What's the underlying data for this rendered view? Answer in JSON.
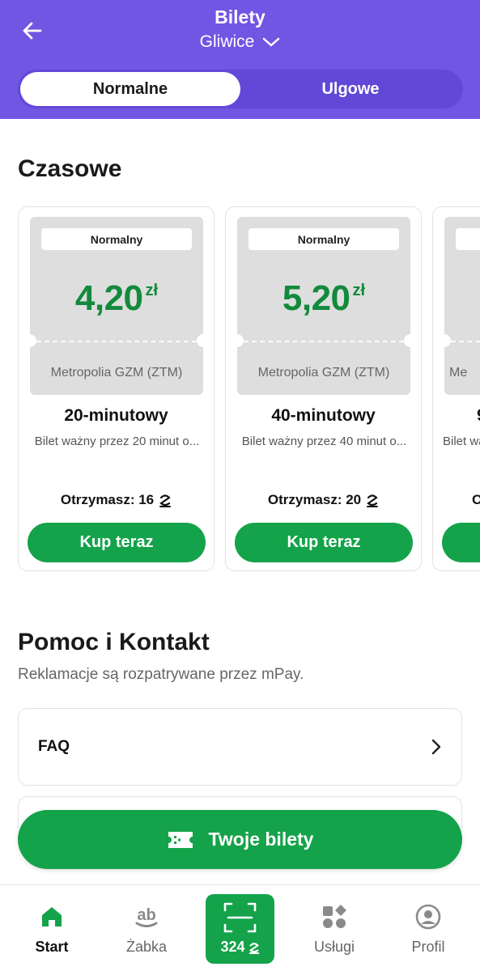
{
  "header": {
    "title": "Bilety",
    "city": "Gliwice",
    "tabs": [
      {
        "label": "Normalne",
        "active": true
      },
      {
        "label": "Ulgowe",
        "active": false
      }
    ]
  },
  "colors": {
    "header_bg": "#7155e3",
    "accent_green": "#14a34a",
    "price_green": "#128a3c"
  },
  "section_timed": {
    "title": "Czasowe",
    "cards": [
      {
        "badge": "Normalny",
        "price": "4,20",
        "currency": "zł",
        "operator": "Metropolia GZM (ZTM)",
        "name": "20-minutowy",
        "description": "Bilet ważny przez 20 minut o...",
        "points_label": "Otrzymasz: 16",
        "button": "Kup teraz"
      },
      {
        "badge": "Normalny",
        "price": "5,20",
        "currency": "zł",
        "operator": "Metropolia GZM (ZTM)",
        "name": "40-minutowy",
        "description": "Bilet ważny przez 40 minut o...",
        "points_label": "Otrzymasz: 20",
        "button": "Kup teraz"
      },
      {
        "badge": "",
        "price": "",
        "currency": "",
        "operator": "Me",
        "name": "9",
        "description": "Bilet wa",
        "points_label": "O",
        "button": ""
      }
    ]
  },
  "help": {
    "title": "Pomoc i Kontakt",
    "subtitle": "Reklamacje są rozpatrywane przez mPay.",
    "faq_label": "FAQ"
  },
  "your_tickets_button": "Twoje bilety",
  "bottom_nav": {
    "items": [
      {
        "label": "Start",
        "icon": "home-icon",
        "active": true
      },
      {
        "label": "Żabka",
        "icon": "zabka-icon",
        "active": false
      },
      {
        "label": "324",
        "icon": "scan-icon",
        "active": false
      },
      {
        "label": "Usługi",
        "icon": "services-icon",
        "active": false
      },
      {
        "label": "Profil",
        "icon": "profile-icon",
        "active": false
      }
    ]
  }
}
